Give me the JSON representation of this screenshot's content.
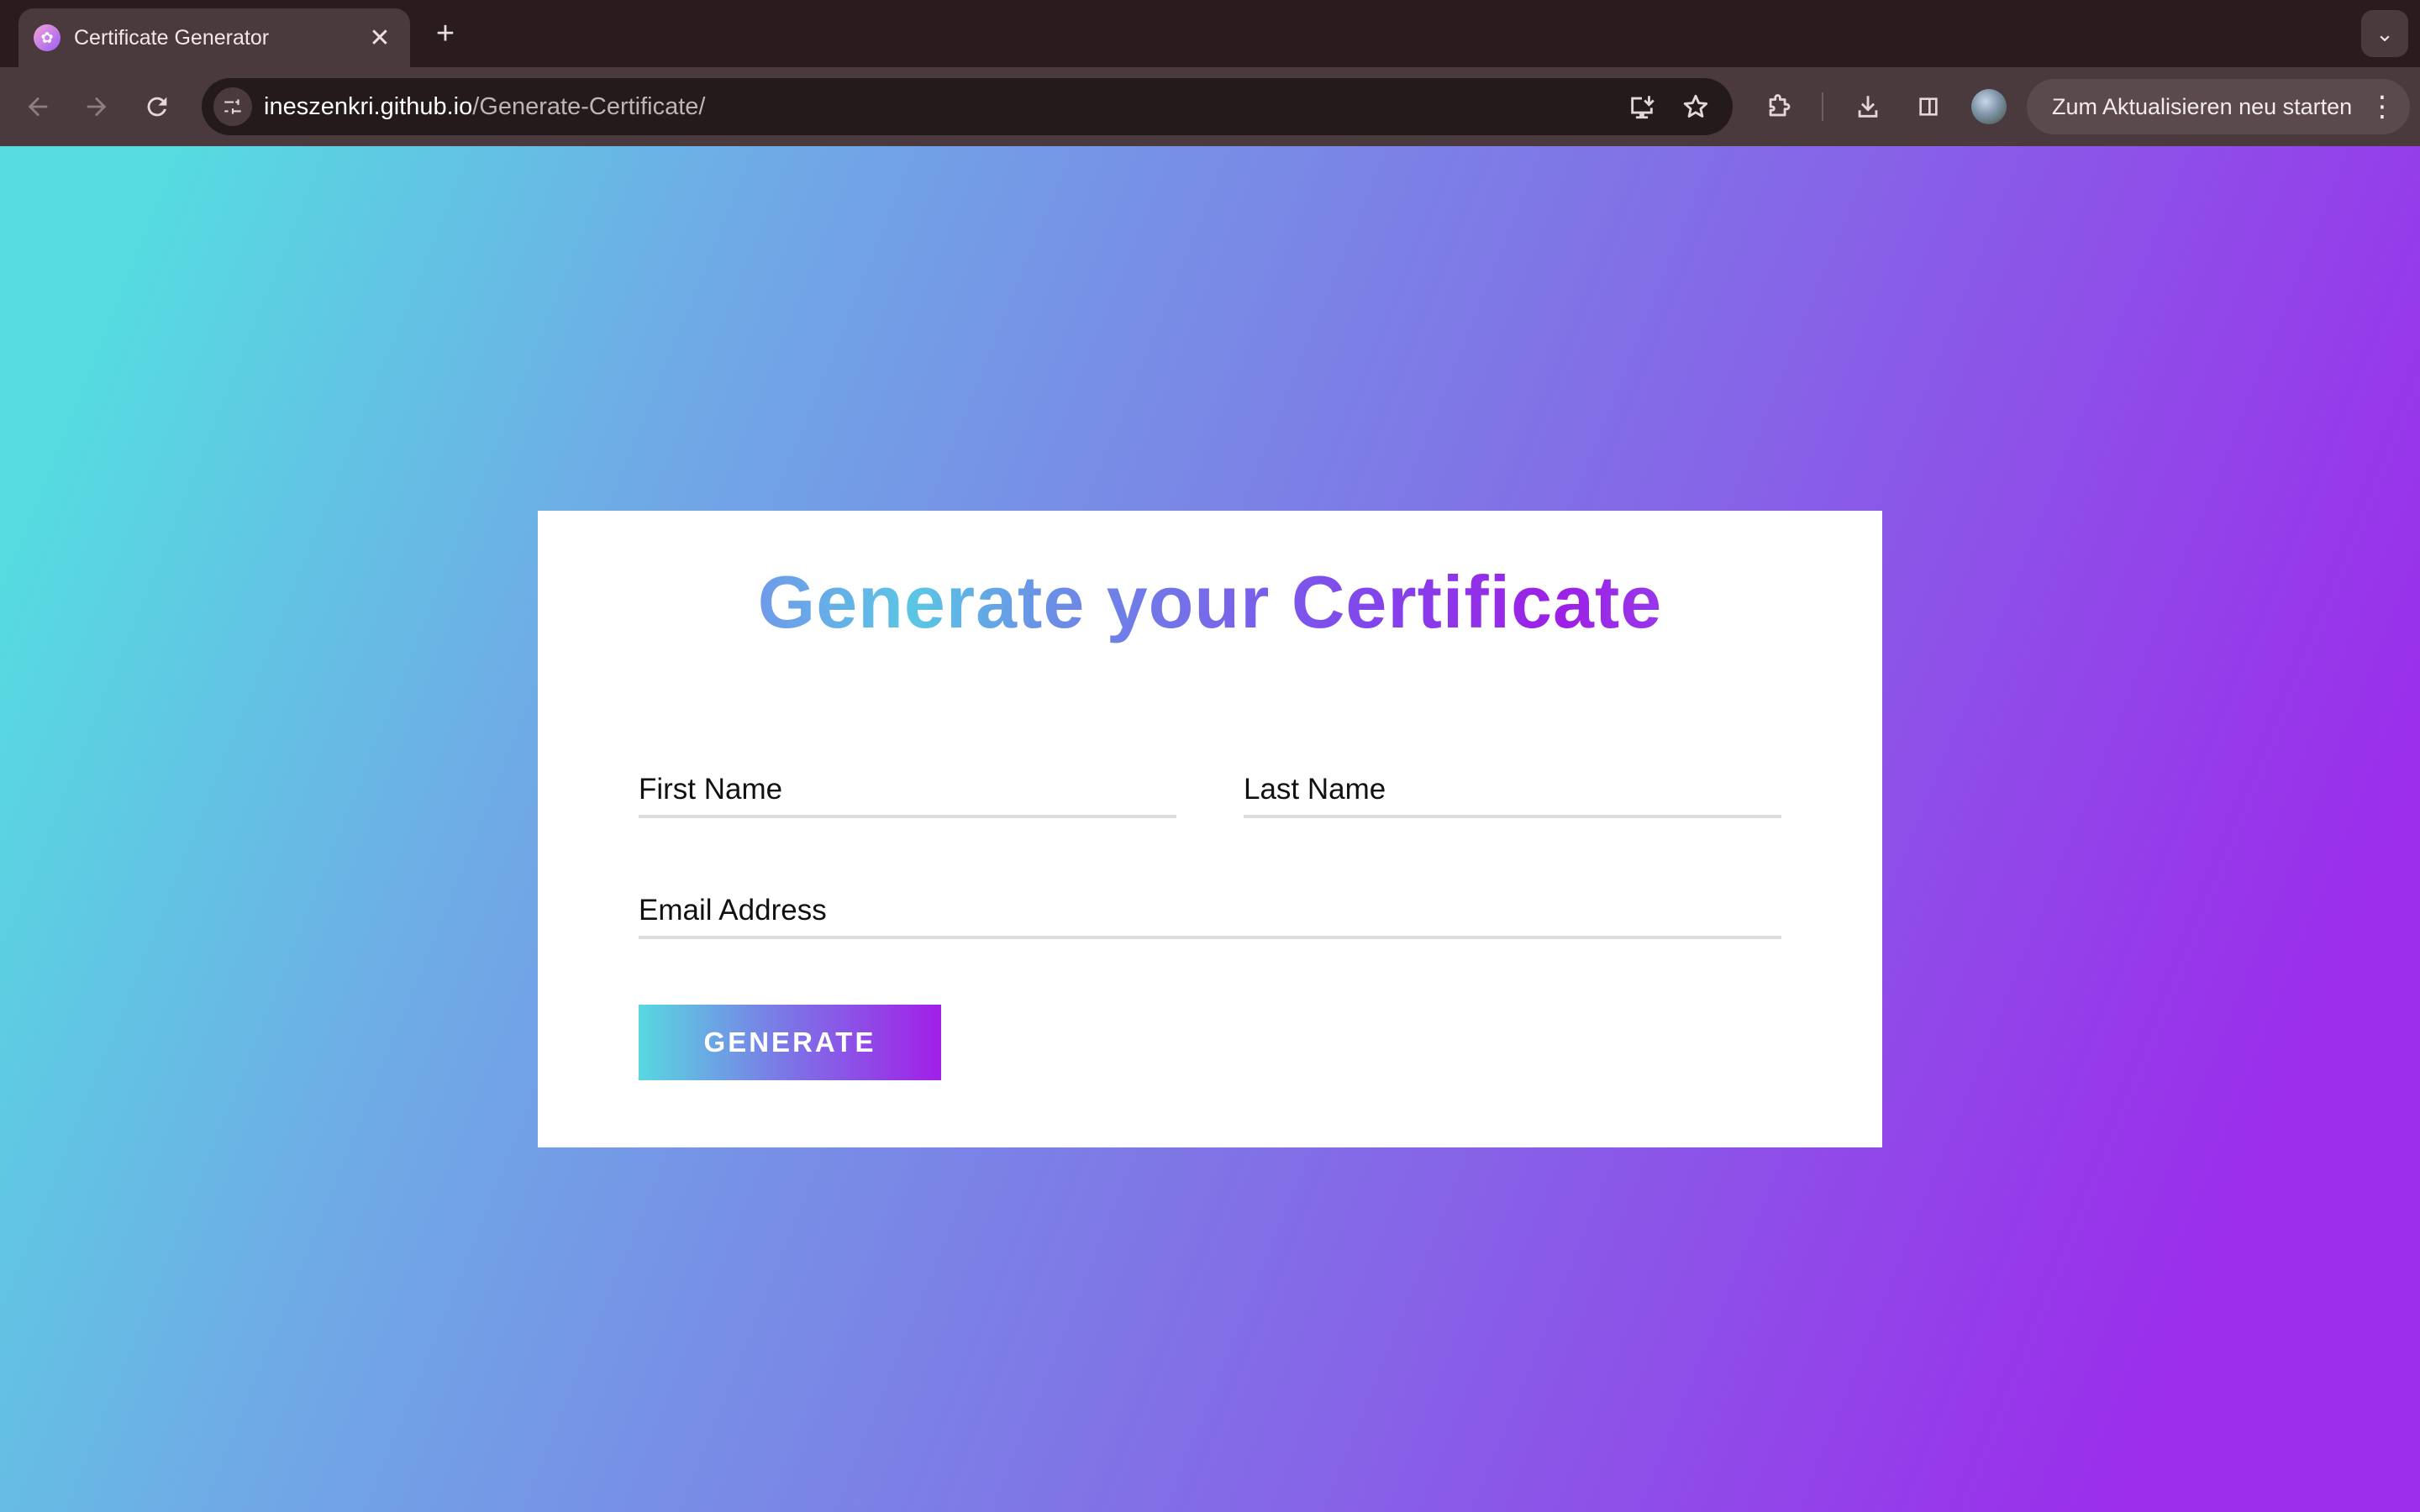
{
  "browser": {
    "tab_title": "Certificate Generator",
    "tab_close": "✕",
    "new_tab": "+",
    "tab_search": "⌄",
    "url_host": "ineszenkri.github.io",
    "url_path": "/Generate-Certificate/",
    "restart_label": "Zum Aktualisieren neu starten",
    "menu": "⋮"
  },
  "form": {
    "title": "Generate your Certificate",
    "first_name_placeholder": "First Name",
    "last_name_placeholder": "Last Name",
    "email_placeholder": "Email Address",
    "generate_label": "GENERATE"
  },
  "colors": {
    "gradient_start": "#56dbe1",
    "gradient_mid": "#8073e6",
    "gradient_end": "#9b2deb",
    "card": "#ffffff"
  }
}
